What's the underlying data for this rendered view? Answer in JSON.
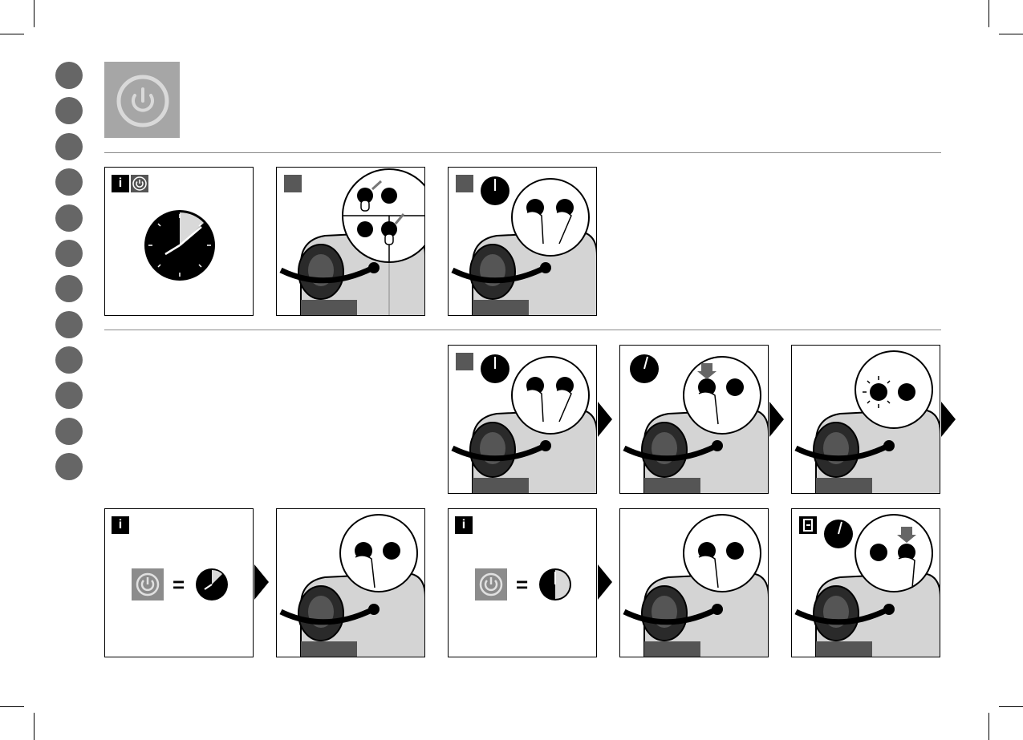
{
  "page": {
    "section_number_dots": 12,
    "colors": {
      "header_icon_bg": "#a6a6a6",
      "dot": "#666666",
      "step_square": "#585858",
      "line": "#8a8a8a"
    }
  },
  "header": {
    "icon": "power-icon"
  },
  "rows": {
    "row1": [
      "info-power-timer",
      "button-check-state",
      "hold-both-buttons"
    ],
    "row2": [
      "hold-both-buttons",
      "press-espresso-button",
      "espresso-light-blinks"
    ],
    "row3": [
      "info-power-equals-timer-9min",
      "press-espresso-button",
      "info-power-equals-timer-30min",
      "press-espresso-button",
      "exit-press-lungo-button"
    ]
  },
  "labels": {
    "info": "i",
    "equals": "="
  },
  "timers": {
    "setting_default_fraction": 0.15,
    "setting_option1_fraction": 0.15,
    "setting_option2_fraction": 0.5
  },
  "icons": [
    "power-icon",
    "info-icon",
    "timer-icon",
    "espresso-cup-icon",
    "lungo-cup-icon",
    "finger-icon",
    "press-arrow-icon",
    "checkmark-icon",
    "exit-icon",
    "next-arrow-icon"
  ]
}
